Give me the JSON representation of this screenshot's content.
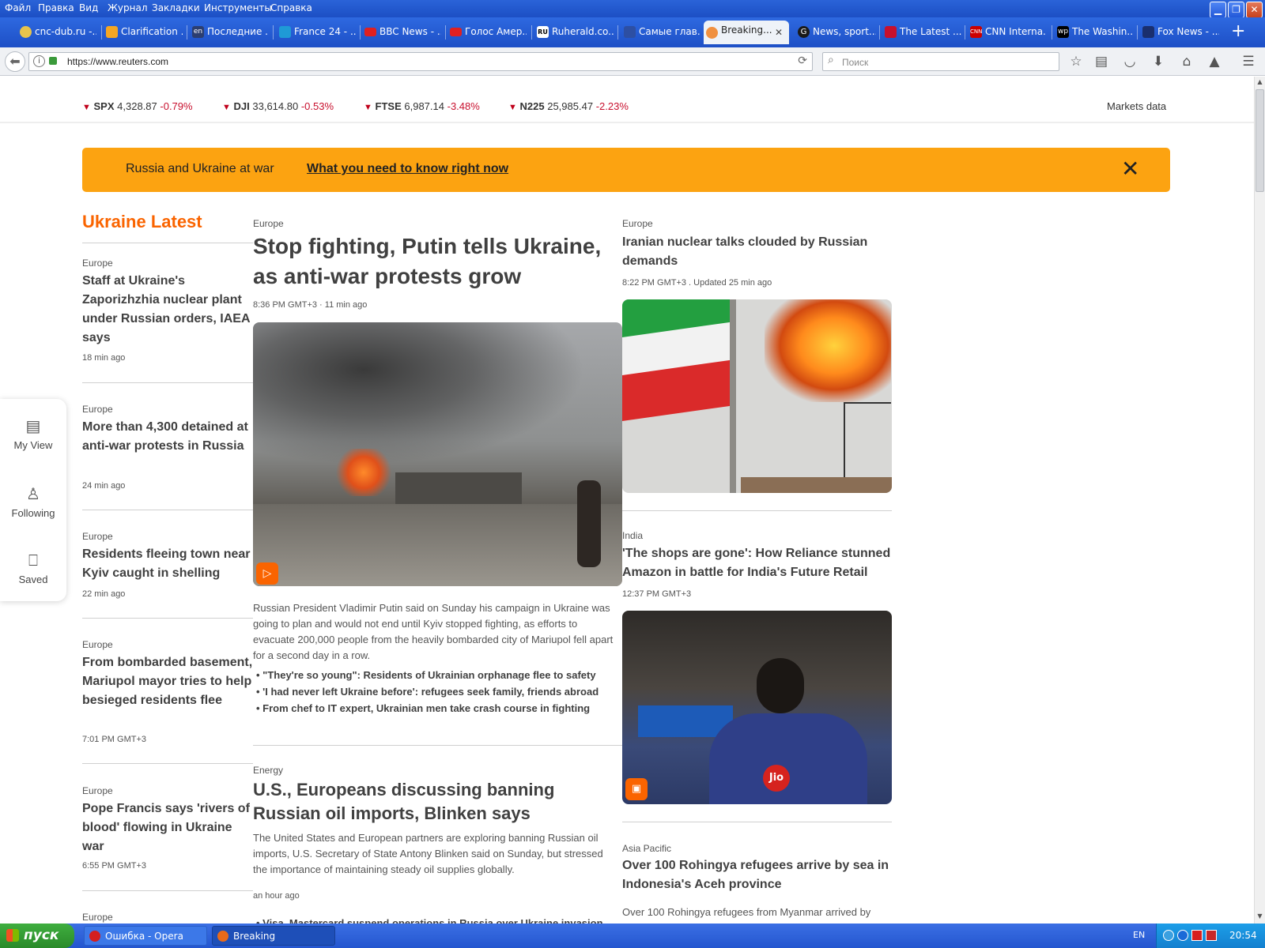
{
  "window": {
    "menus": [
      "Файл",
      "Правка",
      "Вид",
      "Журнал",
      "Закладки",
      "Инструменты",
      "Справка"
    ]
  },
  "tabs": [
    {
      "label": "cnc-dub.ru -...",
      "color": "#e7c34b"
    },
    {
      "label": "Clarification ...",
      "color": "#f5a623"
    },
    {
      "label": "Последние ...",
      "color": "#2c3e70"
    },
    {
      "label": "France 24 - ...",
      "color": "#1f9ad6"
    },
    {
      "label": "BBC News - ...",
      "color": "#e02020"
    },
    {
      "label": "Голос Амер...",
      "color": "#e02020"
    },
    {
      "label": "Ruherald.co...",
      "color": "#ffffff"
    },
    {
      "label": "Самые глав...",
      "color": "#2d4fa3"
    },
    {
      "label": "Breaking...",
      "color": "#f09040",
      "active": true
    },
    {
      "label": "News, sport...",
      "color": "#1a1a1a"
    },
    {
      "label": "The Latest ...",
      "color": "#c8102e"
    },
    {
      "label": "CNN Interna...",
      "color": "#cc0000"
    },
    {
      "label": "The Washin...",
      "color": "#000000"
    },
    {
      "label": "Fox News - ...",
      "color": "#1a2f6e"
    }
  ],
  "navbar": {
    "url": "https://www.reuters.com",
    "search_placeholder": "Поиск"
  },
  "ticker": [
    {
      "symbol": "SPX",
      "value": "4,328.87",
      "change": "-0.79%"
    },
    {
      "symbol": "DJI",
      "value": "33,614.80",
      "change": "-0.53%"
    },
    {
      "symbol": "FTSE",
      "value": "6,987.14",
      "change": "-3.48%"
    },
    {
      "symbol": "N225",
      "value": "25,985.47",
      "change": "-2.23%"
    }
  ],
  "markets_link": "Markets data",
  "banner": {
    "title": "Russia and Ukraine at war",
    "link": "What you need to know right now",
    "close": "✕"
  },
  "sidebar_title": "Ukraine Latest",
  "left_stories": [
    {
      "cat": "Europe",
      "headline": "Staff at Ukraine's Zaporizhzhia nuclear plant under Russian orders, IAEA says",
      "time": "18 min ago"
    },
    {
      "cat": "Europe",
      "headline": "More than 4,300 detained at anti-war protests in Russia",
      "time": "24 min ago"
    },
    {
      "cat": "Europe",
      "headline": "Residents fleeing town near Kyiv caught in shelling",
      "time": "22 min ago"
    },
    {
      "cat": "Europe",
      "headline": "From bombarded basement, Mariupol mayor tries to help besieged residents flee",
      "time": "7:01 PM GMT+3"
    },
    {
      "cat": "Europe",
      "headline": "Pope Francis says 'rivers of blood' flowing in Ukraine war",
      "time": "6:55 PM GMT+3"
    },
    {
      "cat": "Europe"
    }
  ],
  "side_panel": [
    {
      "label": "My View",
      "icon": "▤"
    },
    {
      "label": "Following",
      "icon": "♙"
    },
    {
      "label": "Saved",
      "icon": "⎕"
    }
  ],
  "main_story": {
    "cat": "Europe",
    "headline": "Stop fighting, Putin tells Ukraine, as anti-war protests grow",
    "time": "8:36 PM GMT+3 · 11 min ago",
    "summary": "Russian President Vladimir Putin said on Sunday his campaign in Ukraine was going to plan and would not end until Kyiv stopped fighting, as efforts to evacuate 200,000 people from the heavily bombarded city of Mariupol fell apart for a second day in a row.",
    "bullets": [
      "\"They're so young\": Residents of Ukrainian orphanage flee to safety",
      "'I had never left Ukraine before': refugees seek family, friends abroad",
      "From chef to IT expert, Ukrainian men take crash course in fighting"
    ]
  },
  "second_story": {
    "cat": "Energy",
    "headline": "U.S., Europeans discussing banning Russian oil imports, Blinken says",
    "summary": "The United States and European partners are exploring banning Russian oil imports, U.S. Secretary of State Antony Blinken said on Sunday, but stressed the importance of maintaining steady oil supplies globally.",
    "time": "an hour ago",
    "bullet": "Visa, Mastercard suspend operations in Russia over Ukraine invasion"
  },
  "right_stories": [
    {
      "cat": "Europe",
      "headline": "Iranian nuclear talks clouded by Russian demands",
      "time": "8:22 PM GMT+3 . Updated 25 min ago"
    },
    {
      "cat": "India",
      "headline": "'The shops are gone': How Reliance stunned Amazon in battle for India's Future Retail",
      "time": "12:37 PM GMT+3",
      "jio": "Jio"
    },
    {
      "cat": "Asia Pacific",
      "headline": "Over 100 Rohingya refugees arrive by sea in Indonesia's Aceh province",
      "summary": "Over 100 Rohingya refugees from Myanmar arrived by"
    }
  ],
  "taskbar": {
    "start": "пуск",
    "tasks": [
      "Ошибка - Opera",
      "Breaking Internationa..."
    ],
    "lang": "EN",
    "clock": "20:54"
  }
}
